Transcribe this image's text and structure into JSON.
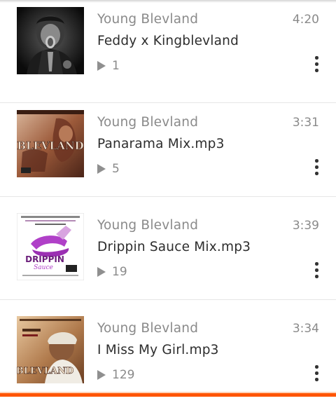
{
  "tracks": [
    {
      "artist": "Young Blevland",
      "title": "Feddy x Kingblevland",
      "duration": "4:20",
      "plays": "1",
      "menu_icon": "more-vertical-icon"
    },
    {
      "artist": "Young Blevland",
      "title": "Panarama Mix.mp3",
      "duration": "3:31",
      "plays": "5",
      "menu_icon": "more-vertical-icon"
    },
    {
      "artist": "Young Blevland",
      "title": "Drippin Sauce Mix.mp3",
      "duration": "3:39",
      "plays": "19",
      "menu_icon": "more-vertical-icon"
    },
    {
      "artist": "Young Blevland",
      "title": "I Miss My Girl.mp3",
      "duration": "3:34",
      "plays": "129",
      "menu_icon": "more-vertical-icon"
    }
  ],
  "art_labels": {
    "track_2": "BLEVLAND",
    "track_3": "DRIPPIN",
    "track_3_sub": "Sauce",
    "track_4": "BLEVLAND"
  },
  "colors": {
    "accent": "#ff5500",
    "text_primary": "#2d2d2d",
    "text_secondary": "#8a8a8a",
    "divider": "#e6e6e6"
  }
}
